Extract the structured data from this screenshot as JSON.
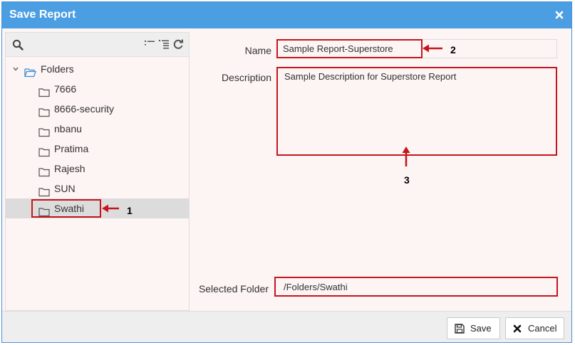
{
  "dialog": {
    "title": "Save Report"
  },
  "tree": {
    "root": {
      "label": "Folders"
    },
    "folders": [
      {
        "label": "7666"
      },
      {
        "label": "8666-security"
      },
      {
        "label": "nbanu"
      },
      {
        "label": "Pratima"
      },
      {
        "label": "Rajesh"
      },
      {
        "label": "SUN"
      },
      {
        "label": "Swathi",
        "selected": true
      }
    ]
  },
  "form": {
    "name_label": "Name",
    "name_value": "Sample Report-Superstore",
    "description_label": "Description",
    "description_value": "Sample Description for Superstore Report",
    "selected_folder_label": "Selected Folder",
    "selected_folder_value": "/Folders/Swathi"
  },
  "annotations": {
    "one": "1",
    "two": "2",
    "three": "3"
  },
  "footer": {
    "save_label": "Save",
    "cancel_label": "Cancel"
  },
  "colors": {
    "titlebar": "#4c9ee3",
    "annotation_red": "#c4161c",
    "panel_bg": "#fdf4f4"
  }
}
